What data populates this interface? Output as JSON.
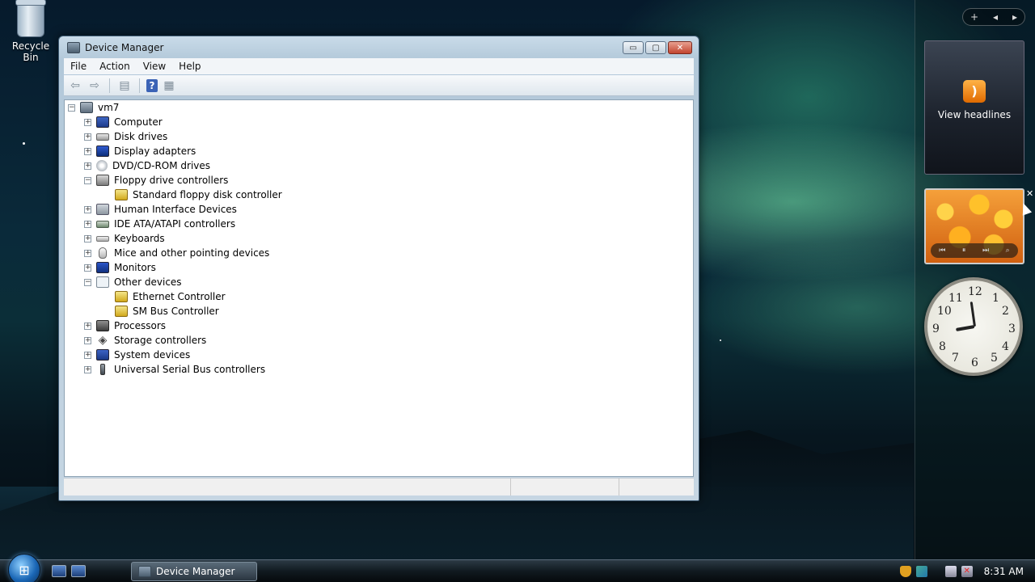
{
  "desktop": {
    "icons": [
      {
        "label": "Recycle Bin",
        "icon": "recycle-bin-icon"
      }
    ]
  },
  "window": {
    "title": "Device Manager",
    "controls": {
      "minimize": "▭",
      "maximize": "▢",
      "close": "✕"
    },
    "menu": [
      "File",
      "Action",
      "View",
      "Help"
    ],
    "toolbar": [
      {
        "icon": "back-arrow-icon",
        "glyph": "⇦"
      },
      {
        "icon": "forward-arrow-icon",
        "glyph": "⇨"
      },
      {
        "icon": "properties-icon",
        "glyph": "▤"
      },
      {
        "icon": "help-icon",
        "glyph": "?"
      },
      {
        "icon": "view-icon",
        "glyph": "▦"
      }
    ],
    "tree": {
      "root": "vm7",
      "nodes": [
        {
          "label": "Computer",
          "icon": "computer-icon",
          "expander": "+"
        },
        {
          "label": "Disk drives",
          "icon": "disk-drive-icon",
          "expander": "+"
        },
        {
          "label": "Display adapters",
          "icon": "display-adapter-icon",
          "expander": "+"
        },
        {
          "label": "DVD/CD-ROM drives",
          "icon": "dvd-drive-icon",
          "expander": "+"
        },
        {
          "label": "Floppy drive controllers",
          "icon": "floppy-controller-icon",
          "expander": "−"
        },
        {
          "label": "Standard floppy disk controller",
          "icon": "floppy-device-icon",
          "expander": ""
        },
        {
          "label": "Human Interface Devices",
          "icon": "hid-icon",
          "expander": "+"
        },
        {
          "label": "IDE ATA/ATAPI controllers",
          "icon": "ide-controller-icon",
          "expander": "+"
        },
        {
          "label": "Keyboards",
          "icon": "keyboard-icon",
          "expander": "+"
        },
        {
          "label": "Mice and other pointing devices",
          "icon": "mouse-icon",
          "expander": "+"
        },
        {
          "label": "Monitors",
          "icon": "monitor-icon",
          "expander": "+"
        },
        {
          "label": "Other devices",
          "icon": "unknown-device-icon",
          "expander": "−"
        },
        {
          "label": "Ethernet Controller",
          "icon": "warning-device-icon",
          "expander": ""
        },
        {
          "label": "SM Bus Controller",
          "icon": "warning-device-icon",
          "expander": ""
        },
        {
          "label": "Processors",
          "icon": "processor-icon",
          "expander": "+"
        },
        {
          "label": "Storage controllers",
          "icon": "storage-controller-icon",
          "expander": "+"
        },
        {
          "label": "System devices",
          "icon": "system-device-icon",
          "expander": "+"
        },
        {
          "label": "Universal Serial Bus controllers",
          "icon": "usb-icon",
          "expander": "+"
        }
      ]
    }
  },
  "sidebar": {
    "controls": [
      "+",
      "◂",
      "▸"
    ],
    "feed": {
      "label": "View headlines",
      "icon": "rss-icon"
    },
    "slideshow": {
      "icon": "photo-slideshow-icon",
      "controls": [
        "⏮",
        "⏸",
        "⏭",
        "⌕"
      ],
      "close": "✕"
    },
    "clock": {
      "icon": "analog-clock-icon",
      "numerals": [
        "12",
        "1",
        "2",
        "3",
        "4",
        "5",
        "6",
        "7",
        "8",
        "9",
        "10",
        "11"
      ]
    }
  },
  "taskbar": {
    "start": "start-orb-icon",
    "quick_launch": [
      "show-desktop-icon",
      "switch-windows-icon"
    ],
    "active_task": "Device Manager",
    "tray_icons": [
      "security-shield-icon",
      "network-icon",
      "network-status-icon",
      "volume-muted-icon"
    ],
    "time": "8:31 AM"
  },
  "colors": {
    "window_frame": "#c9dbe9",
    "taskbar": "#111a20",
    "close_button": "#c2442e",
    "selection_accent": "#3b63b6"
  }
}
